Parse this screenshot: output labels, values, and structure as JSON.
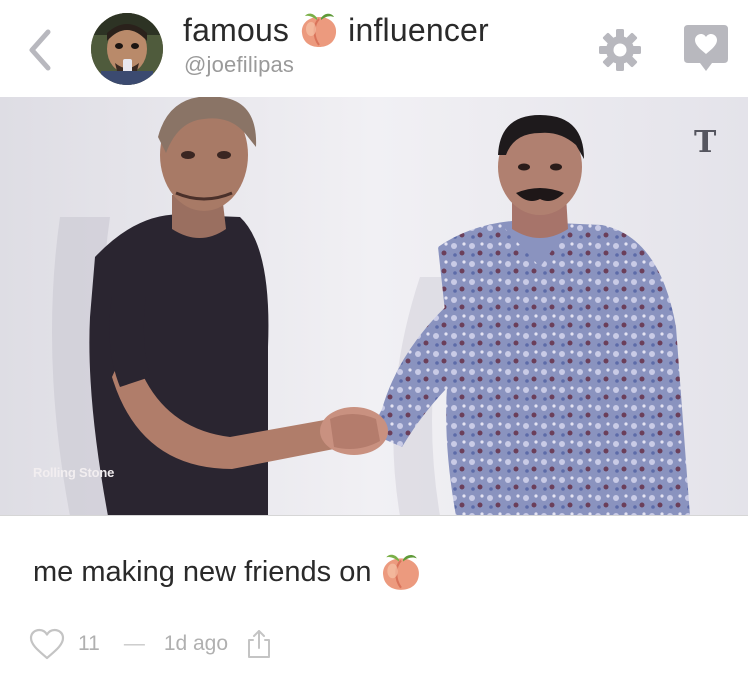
{
  "header": {
    "back_icon": "chevron-left-icon",
    "avatar": "user-avatar",
    "name_first": "famous",
    "name_emoji": "peach-emoji",
    "name_last": "influencer",
    "handle": "@joefilipas",
    "settings_icon": "gear-icon",
    "favorite_icon": "heart-tag-icon"
  },
  "post": {
    "photo": "two-men-shaking-hands-photo",
    "watermark_left": "Rolling Stone",
    "watermark_right": "T",
    "caption": "me making new friends on",
    "caption_emoji": "peach-emoji",
    "likes": "11",
    "separator": "—",
    "timestamp": "1d ago",
    "like_icon": "heart-outline-icon",
    "share_icon": "share-icon"
  },
  "colors": {
    "accent_gray": "#b8b8be",
    "text_primary": "#2a2a2a",
    "text_secondary": "#9a9a9a",
    "peach": "#e8927a"
  }
}
